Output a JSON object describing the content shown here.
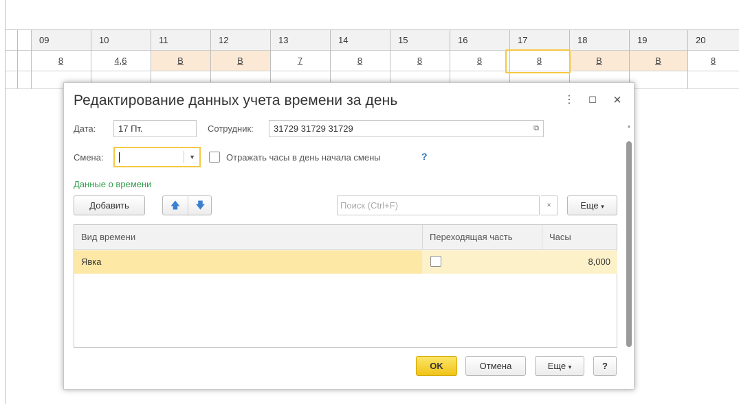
{
  "timesheet": {
    "days": [
      "09",
      "10",
      "11",
      "12",
      "13",
      "14",
      "15",
      "16",
      "17",
      "18",
      "19",
      "20"
    ],
    "values": [
      "8",
      "4,6",
      "В",
      "В",
      "7",
      "8",
      "8",
      "8",
      "8",
      "В",
      "В",
      "8"
    ],
    "weekend_flags": [
      false,
      false,
      true,
      true,
      false,
      false,
      false,
      false,
      false,
      true,
      true,
      false
    ]
  },
  "dialog": {
    "title": "Редактирование данных учета времени за день",
    "date_label": "Дата:",
    "date_value": "17 Пт.",
    "employee_label": "Сотрудник:",
    "employee_value": "31729 31729 31729",
    "shift_label": "Смена:",
    "shift_value": "",
    "reflect_hours_label": "Отражать часы в день начала смены",
    "reflect_hours_checked": false,
    "help_mark": "?",
    "section_title": "Данные о времени",
    "add_button": "Добавить",
    "search_placeholder": "Поиск (Ctrl+F)",
    "clear_glyph": "×",
    "more_button": "Еще",
    "table": {
      "columns": [
        "Вид времени",
        "Переходящая часть",
        "Часы"
      ],
      "rows": [
        {
          "kind": "Явка",
          "carryover": false,
          "hours": "8,000"
        }
      ]
    },
    "footer": {
      "ok": "OK",
      "cancel": "Отмена",
      "more": "Еще",
      "help": "?"
    }
  },
  "colors": {
    "focus_border": "#f5c842",
    "weekend_cell": "#fbe9d6",
    "selected_row": "#fdeeb0",
    "section_title": "#2e9e4a",
    "ok_button": "#f1c318",
    "arrow_buttons": "#3b7fd1"
  }
}
